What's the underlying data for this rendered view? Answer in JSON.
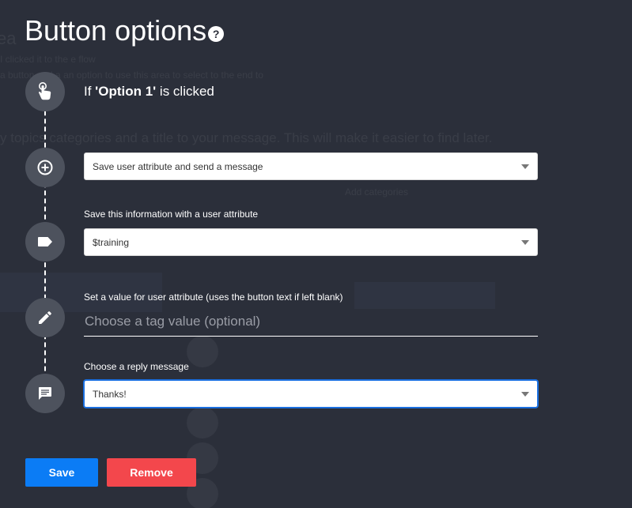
{
  "modal": {
    "title": "Button options",
    "help_icon": "question-circle-icon"
  },
  "trigger": {
    "prefix": "If ",
    "option": "'Option 1'",
    "suffix": " is clicked",
    "icon": "tap-hand-icon"
  },
  "action": {
    "icon": "plus-circle-icon",
    "selected": "Save user attribute and send a message"
  },
  "attribute": {
    "icon": "tag-icon",
    "label": "Save this information with a user attribute",
    "selected": "$training"
  },
  "value": {
    "icon": "pencil-icon",
    "label": "Set a value for user attribute (uses the button text if left blank)",
    "placeholder": "Choose a tag value (optional)",
    "value": ""
  },
  "reply": {
    "icon": "chat-icon",
    "label": "Choose a reply message",
    "selected": "Thanks!"
  },
  "buttons": {
    "save": "Save",
    "remove": "Remove"
  },
  "colors": {
    "overlay": "#2b2f3a",
    "step_circle": "#4d525d",
    "save": "#0b7cf5",
    "remove": "#f3474c",
    "focus": "#1a6fe0"
  }
}
